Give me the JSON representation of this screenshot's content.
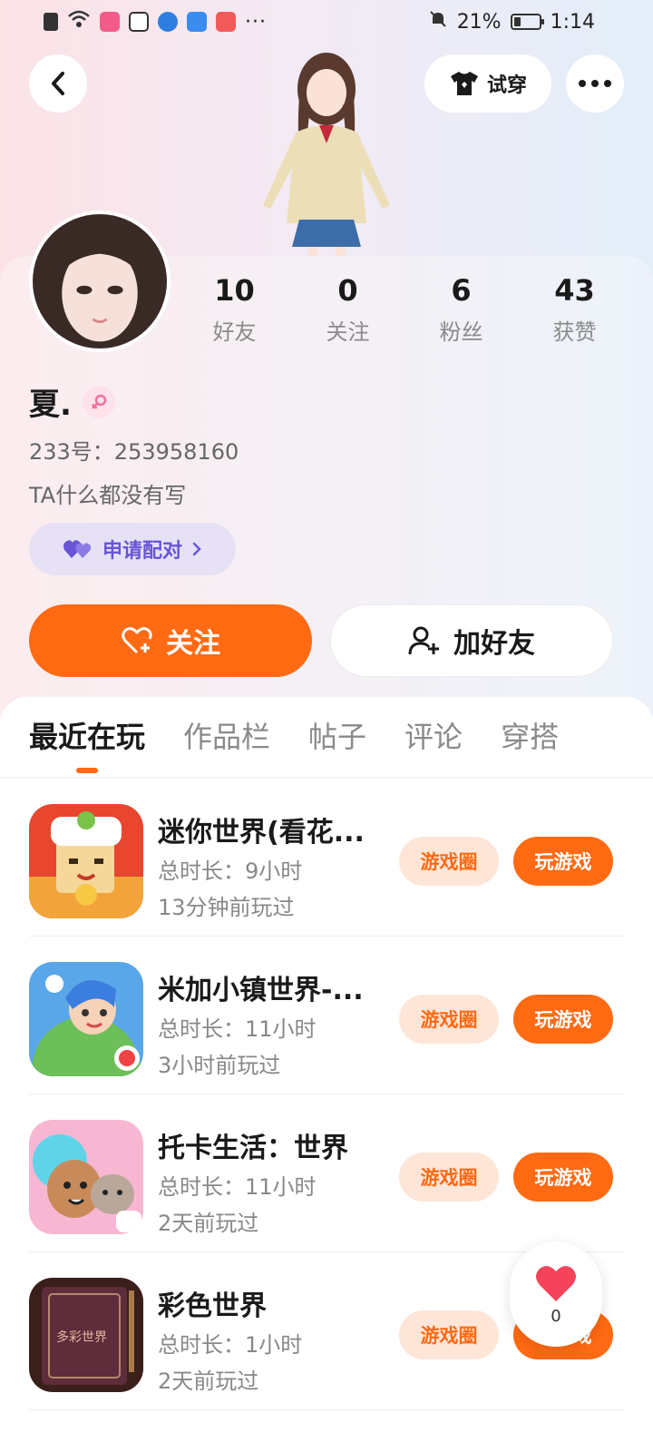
{
  "status_bar": {
    "battery_percent": "21%",
    "time": "1:14",
    "more_indicator": "···"
  },
  "header": {
    "try_on_label": "试穿"
  },
  "profile": {
    "stats": [
      {
        "value": "10",
        "label": "好友"
      },
      {
        "value": "0",
        "label": "关注"
      },
      {
        "value": "6",
        "label": "粉丝"
      },
      {
        "value": "43",
        "label": "获赞"
      }
    ],
    "name": "夏.",
    "gender_icon": "female-icon",
    "uid": "233号：253958160",
    "bio": "TA什么都没有写",
    "pair_label": "申请配对",
    "follow_label": "关注",
    "add_friend_label": "加好友"
  },
  "tabs": [
    {
      "label": "最近在玩",
      "active": true
    },
    {
      "label": "作品栏",
      "active": false
    },
    {
      "label": "帖子",
      "active": false
    },
    {
      "label": "评论",
      "active": false
    },
    {
      "label": "穿搭",
      "active": false
    }
  ],
  "games": [
    {
      "title": "迷你世界(看花...",
      "duration": "总时长：9小时",
      "last_played": "13分钟前玩过",
      "circle_label": "游戏圈",
      "play_label": "玩游戏"
    },
    {
      "title": "米加小镇世界-...",
      "duration": "总时长：11小时",
      "last_played": "3小时前玩过",
      "circle_label": "游戏圈",
      "play_label": "玩游戏"
    },
    {
      "title": "托卡生活：世界",
      "duration": "总时长：11小时",
      "last_played": "2天前玩过",
      "circle_label": "游戏圈",
      "play_label": "玩游戏"
    },
    {
      "title": "彩色世界",
      "duration": "总时长：1小时",
      "last_played": "2天前玩过",
      "circle_label": "游戏圈",
      "play_label": "玩游戏",
      "icon_text": "多彩世界"
    }
  ],
  "like_float": {
    "count": "0"
  },
  "colors": {
    "accent": "#ff6a13",
    "accent_light": "#fde6d8",
    "pair_purple": "#6a54d8",
    "pair_bg": "#e7e1f6"
  }
}
